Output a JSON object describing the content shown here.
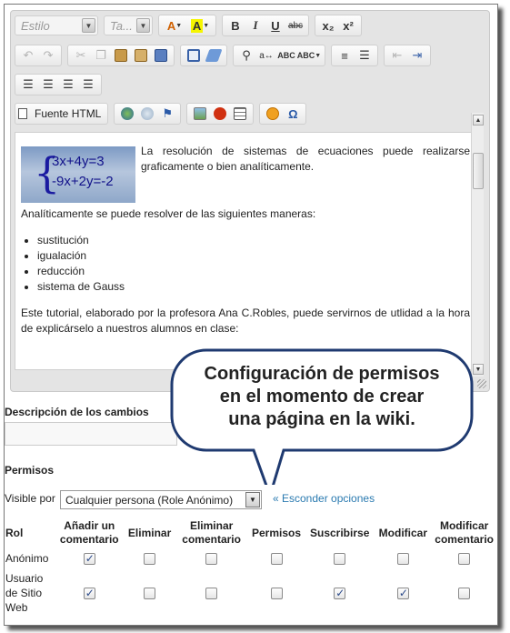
{
  "toolbar": {
    "style_combo": "Estilo",
    "size_combo": "Ta...",
    "source_label": "Fuente HTML",
    "bold": "B",
    "italic": "I",
    "underline": "U",
    "strike": "abc",
    "subscript": "x₂",
    "superscript": "x²",
    "text_color": "A",
    "bg_color": "A"
  },
  "content": {
    "eq1": "3x+4y=3",
    "eq2": "-9x+2y=-2",
    "intro": "La resolución de sistemas de ecuaciones puede realizarse graficamente o bien analíticamente.",
    "analytic": "Analíticamente se puede resolver de las siguientes maneras:",
    "methods": [
      "sustitución",
      "igualación",
      "reducción",
      "sistema de Gauss"
    ],
    "tutorial": "Este tutorial, elaborado por la profesora Ana C.Robles, puede servirnos de utlidad a la hora de explicárselo a nuestros alumnos en clase:"
  },
  "callout": {
    "lines": [
      "Configuración de permisos",
      "en el momento de crear",
      "una página en la wiki."
    ]
  },
  "form": {
    "description_label": "Descripción de los cambios",
    "permissions_label": "Permisos",
    "visible_label": "Visible por",
    "visible_value": "Cualquier persona (Role Anónimo)",
    "hide_options_link": "« Esconder opciones"
  },
  "permissions_table": {
    "headers": {
      "rol": "Rol",
      "add_comment_1": "Añadir un",
      "add_comment_2": "comentario",
      "delete": "Eliminar",
      "delete_comment_1": "Eliminar",
      "delete_comment_2": "comentario",
      "permissions": "Permisos",
      "subscribe": "Suscribirse",
      "modify": "Modificar",
      "modify_comment_1": "Modificar",
      "modify_comment_2": "comentario"
    },
    "rows": [
      {
        "role": "Anónimo",
        "checks": [
          true,
          false,
          false,
          false,
          false,
          false,
          false
        ]
      },
      {
        "role_1": "Usuario",
        "role_2": "de Sitio",
        "role_3": "Web",
        "checks": [
          true,
          false,
          false,
          false,
          true,
          true,
          false
        ]
      }
    ]
  }
}
